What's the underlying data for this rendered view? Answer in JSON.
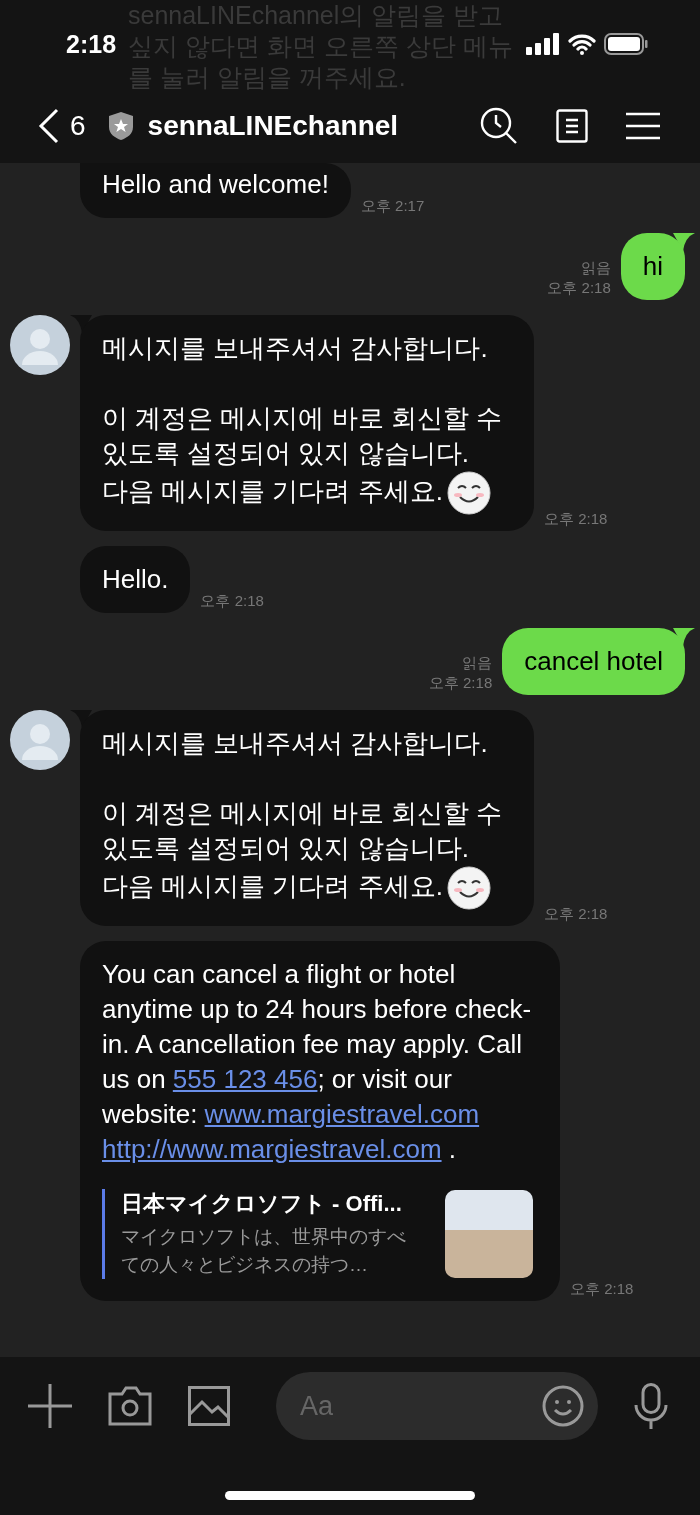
{
  "status_bar": {
    "time": "2:18"
  },
  "header": {
    "faded_text": "sennaLINEchannel의 알림을 받고 싶지 않다면 화면 오른쪽 상단 메뉴를 눌러 알림을 꺼주세요.",
    "back_count": "6",
    "title": "sennaLINEchannel"
  },
  "messages": [
    {
      "kind": "received",
      "avatar": false,
      "text": "Hello and welcome!",
      "sticker": false,
      "time": "오후 2:17"
    },
    {
      "kind": "sent",
      "text": "hi",
      "read": "읽음",
      "time": "오후 2:18"
    },
    {
      "kind": "received",
      "avatar": true,
      "text": "메시지를 보내주셔서 감사합니다.\n\n이 계정은 메시지에 바로 회신할 수 있도록 설정되어 있지 않습니다.\n다음 메시지를 기다려 주세요.",
      "sticker": true,
      "time": "오후 2:18"
    },
    {
      "kind": "received",
      "avatar": false,
      "text": "Hello.",
      "sticker": false,
      "time": "오후 2:18"
    },
    {
      "kind": "sent",
      "text": "cancel hotel",
      "read": "읽음",
      "time": "오후 2:18"
    },
    {
      "kind": "received",
      "avatar": true,
      "text": "메시지를 보내주셔서 감사합니다.\n\n이 계정은 메시지에 바로 회신할 수 있도록 설정되어 있지 않습니다.\n다음 메시지를 기다려 주세요.",
      "sticker": true,
      "time": "오후 2:18"
    },
    {
      "kind": "linked",
      "avatar": false,
      "segments": [
        {
          "kind": "plain",
          "text": "You can cancel a flight or hotel anytime up to 24 hours before check-in. A cancellation fee may apply. Call us on "
        },
        {
          "kind": "link",
          "text": "555 123 456"
        },
        {
          "kind": "plain",
          "text": "; or visit our website: "
        },
        {
          "kind": "link",
          "text": "www.margiestravel.com"
        },
        {
          "kind": "link",
          "text": "http://www.margiestravel.com"
        },
        {
          "kind": "plain",
          "text": " ."
        }
      ],
      "preview": {
        "title": "日本マイクロソフト - Offi...",
        "description": "マイクロソフトは、世界中のすべての人々とビジネスの持つ…"
      },
      "time": "오후 2:18"
    }
  ],
  "composer": {
    "placeholder": "Aa"
  }
}
